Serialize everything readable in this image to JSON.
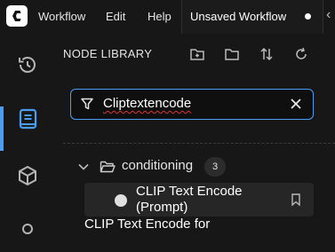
{
  "menu": {
    "workflow": "Workflow",
    "edit": "Edit",
    "help": "Help"
  },
  "tab": {
    "label": "Unsaved Workflow"
  },
  "panel": {
    "title": "NODE LIBRARY"
  },
  "search": {
    "value": "Cliptextencode"
  },
  "tree": {
    "folder_label": "conditioning",
    "count": "3"
  },
  "nodes": [
    {
      "label": "CLIP Text Encode (Prompt)"
    },
    {
      "label": "CLIP Text Encode for"
    }
  ],
  "colors": {
    "accent": "#4a9df0",
    "background": "#171717"
  },
  "icons": {
    "sidebar": [
      "history-icon",
      "node-library-icon",
      "model-library-icon"
    ],
    "panel_header": [
      "new-folder-icon",
      "folder-icon",
      "sort-icon",
      "refresh-icon"
    ]
  }
}
